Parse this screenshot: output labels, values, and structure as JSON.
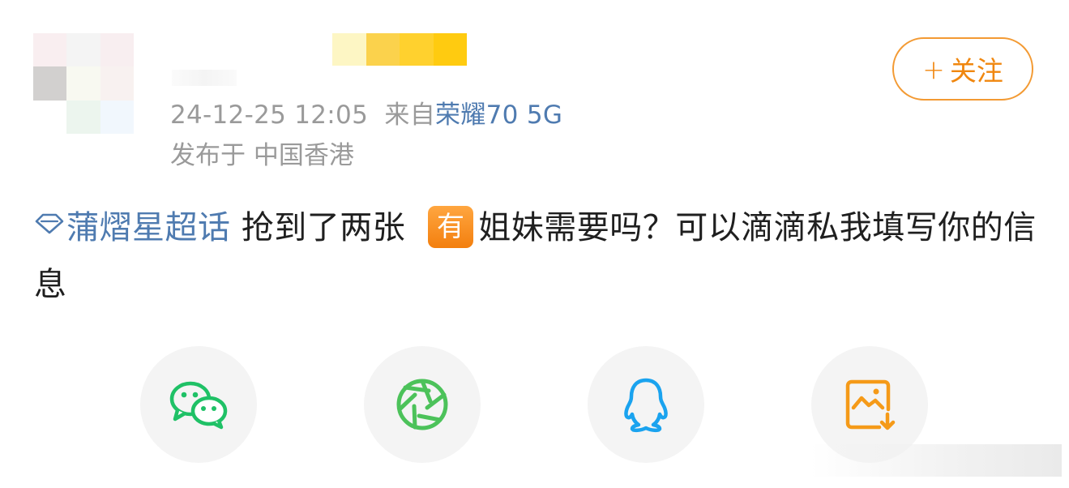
{
  "post": {
    "timestamp": "24-12-25 12:05",
    "source_prefix": "来自",
    "source_device": "荣耀70 5G",
    "location": "发布于 中国香港",
    "topic": "蒲熠星超话",
    "text_before_badge": " 抢到了两张",
    "badge": "有",
    "text_after_badge": "姐妹需要吗？可以滴滴私我填写你的信息"
  },
  "follow_button": {
    "plus": "+",
    "label": "关注"
  },
  "share": {
    "icons": [
      "wechat-icon",
      "moments-icon",
      "qq-icon",
      "save-image-icon"
    ]
  },
  "colors": {
    "link": "#4f7bb0",
    "accent": "#f0870f",
    "wechat": "#1fc166",
    "moments": "#4cc25a",
    "qq": "#1aa3ef",
    "save": "#f59a18"
  }
}
